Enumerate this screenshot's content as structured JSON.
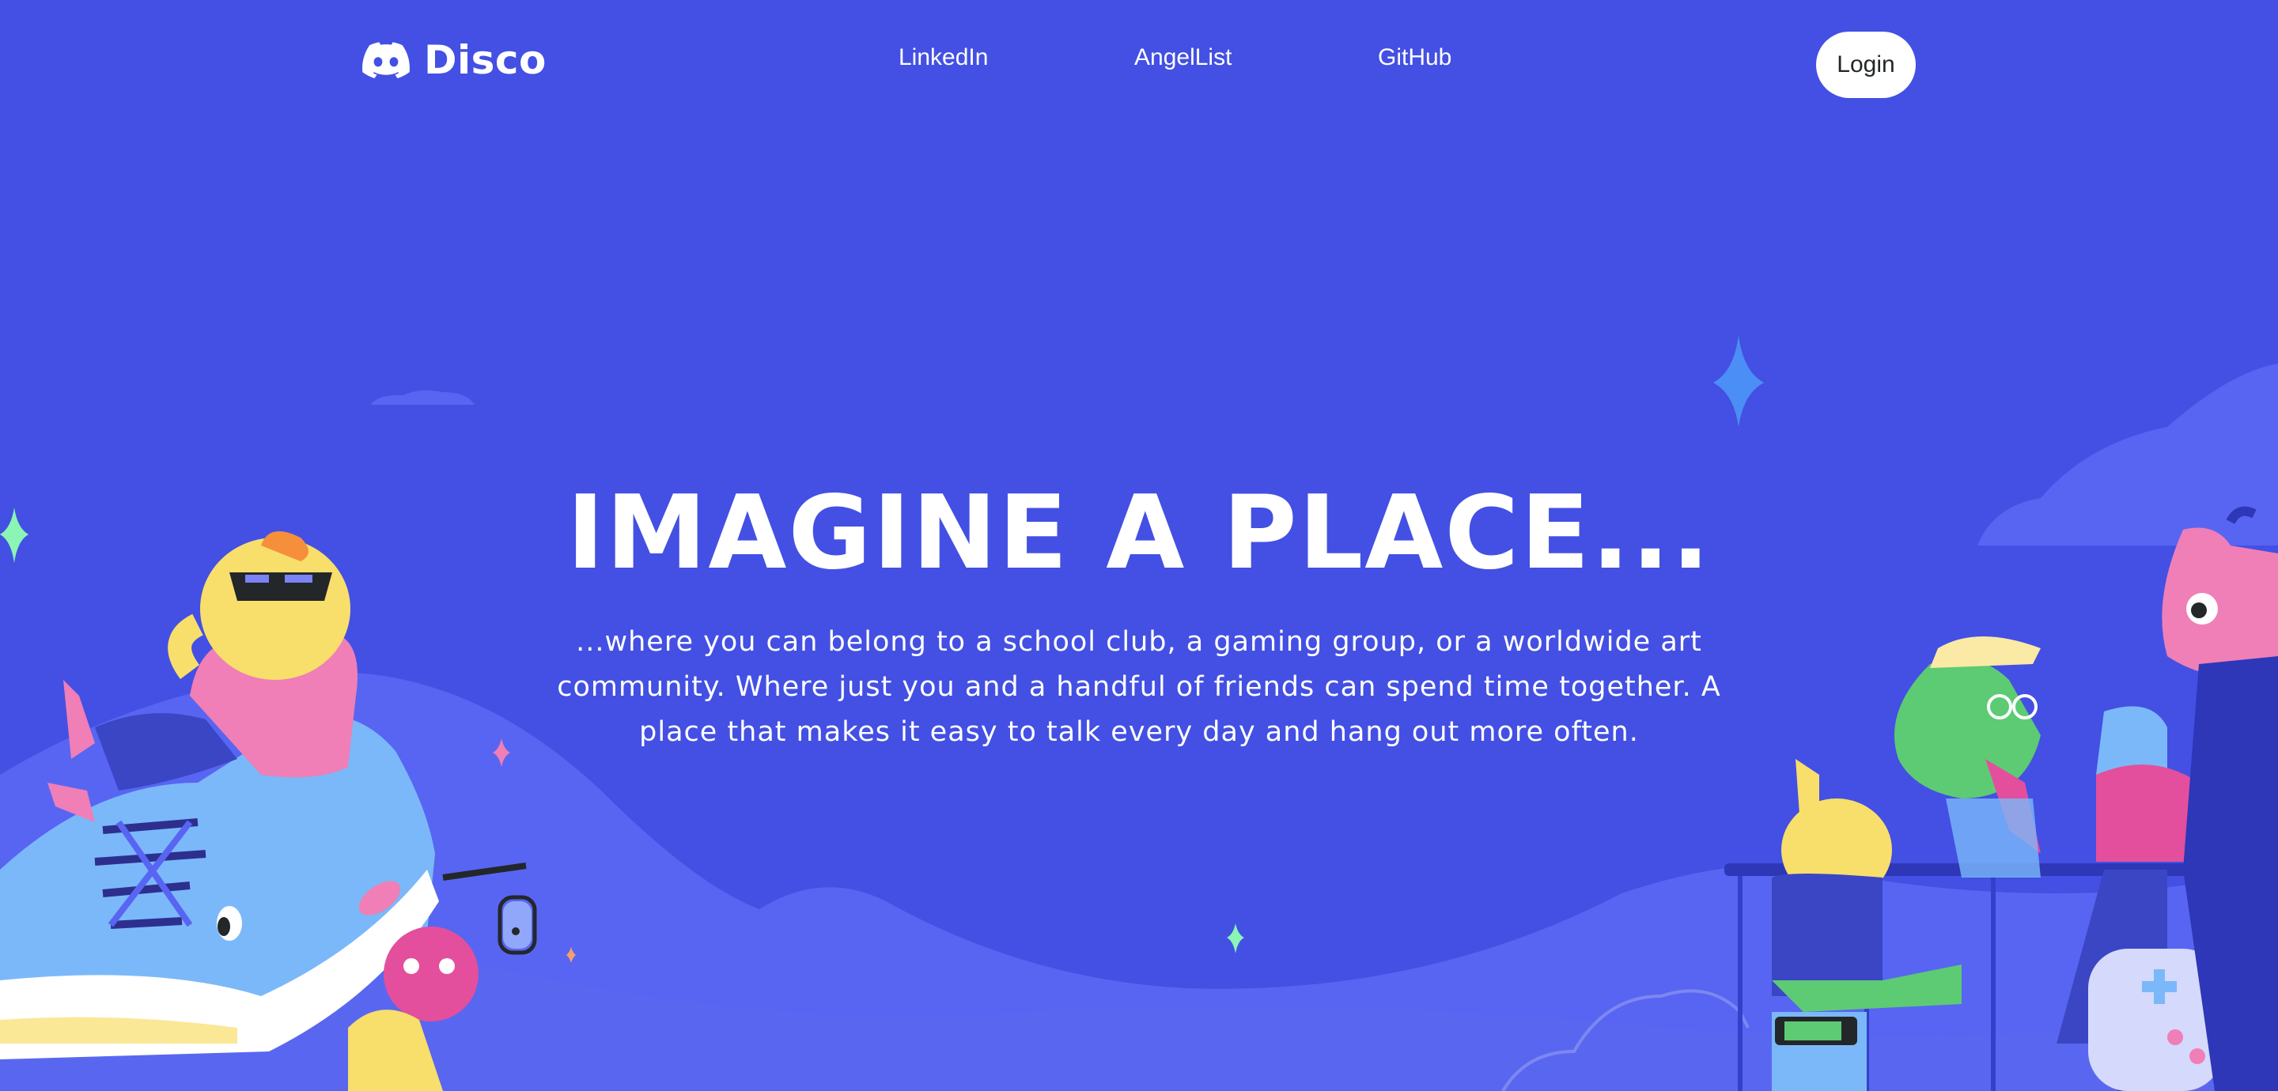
{
  "header": {
    "brand_name": "Disco",
    "nav": {
      "linkedin": "LinkedIn",
      "angellist": "AngelList",
      "github": "GitHub"
    },
    "login_label": "Login"
  },
  "hero": {
    "title": "IMAGINE A PLACE...",
    "body": "...where you can belong to a school club, a gaming group, or a worldwide art community. Where just you and a handful of friends can spend time together. A place that makes it easy to talk every day and hang out more often."
  },
  "colors": {
    "background": "#4350e3",
    "hill": "#5865f2",
    "accent_blue": "#7bb8f9",
    "pink": "#ef7fb6",
    "yellow": "#f8de6b",
    "green": "#5ccb73"
  },
  "icons": [
    "discord-logo-icon",
    "sparkle-icon",
    "cloud-icon",
    "gamepad-icon"
  ]
}
